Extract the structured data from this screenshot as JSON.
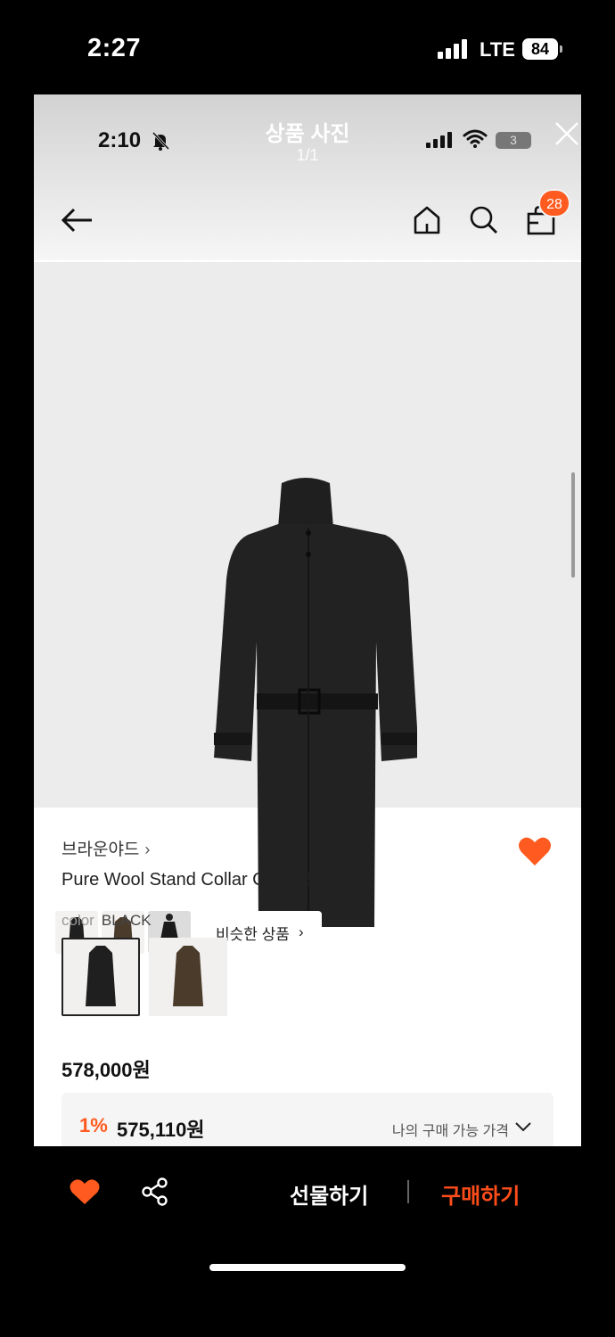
{
  "outer_status": {
    "time": "2:27",
    "network": "LTE",
    "battery": "84"
  },
  "viewer": {
    "title": "상품 사진",
    "counter": "1/1",
    "inner_time": "2:10",
    "inner_battery": "3"
  },
  "header": {
    "cart_count": "28"
  },
  "gallery": {
    "similar_label": "비슷한 상품"
  },
  "product": {
    "brand": "브라운야드",
    "name": "Pure Wool Stand Collar Coat, Black",
    "color_label": "color",
    "color_value": "BLACK",
    "price": "578,000원",
    "discount_rate": "1%",
    "discount_price": "575,110원",
    "my_price_label": "나의 구매 가능 가격"
  },
  "bottom_bar": {
    "gift_label": "선물하기",
    "buy_label": "구매하기"
  },
  "colors": {
    "accent": "#ff5a1f",
    "coat_black": "#1f1f1f",
    "coat_brown": "#4a3b2b"
  }
}
